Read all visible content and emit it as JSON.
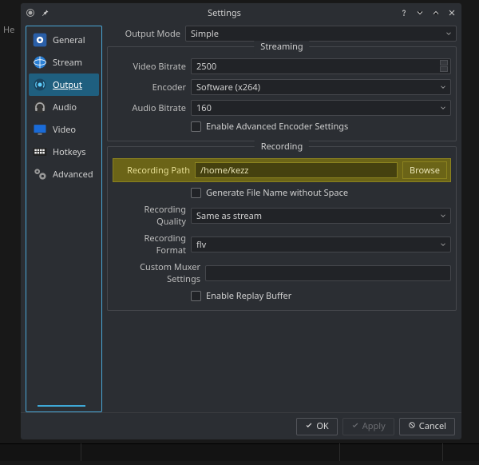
{
  "window": {
    "title": "Settings"
  },
  "sidebar": {
    "items": [
      {
        "label": "General"
      },
      {
        "label": "Stream"
      },
      {
        "label": "Output"
      },
      {
        "label": "Audio"
      },
      {
        "label": "Video"
      },
      {
        "label": "Hotkeys"
      },
      {
        "label": "Advanced"
      }
    ]
  },
  "output_mode": {
    "label": "Output Mode",
    "value": "Simple"
  },
  "streaming": {
    "title": "Streaming",
    "video_bitrate": {
      "label": "Video Bitrate",
      "value": "2500"
    },
    "encoder": {
      "label": "Encoder",
      "value": "Software (x264)"
    },
    "audio_bitrate": {
      "label": "Audio Bitrate",
      "value": "160"
    },
    "advanced_checkbox": "Enable Advanced Encoder Settings"
  },
  "recording": {
    "title": "Recording",
    "path": {
      "label": "Recording Path",
      "value": "/home/kezz",
      "browse": "Browse"
    },
    "filename_checkbox": "Generate File Name without Space",
    "quality": {
      "label": "Recording Quality",
      "value": "Same as stream"
    },
    "format": {
      "label": "Recording Format",
      "value": "flv"
    },
    "muxer": {
      "label": "Custom Muxer Settings",
      "value": ""
    },
    "replay_checkbox": "Enable Replay Buffer"
  },
  "buttons": {
    "ok": "OK",
    "apply": "Apply",
    "cancel": "Cancel"
  },
  "backdrop": {
    "he": "He"
  }
}
